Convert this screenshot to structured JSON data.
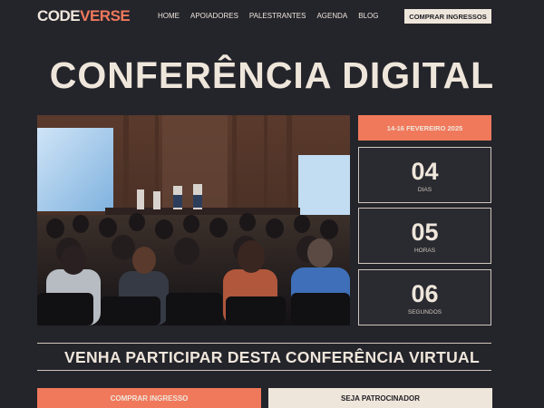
{
  "brand": {
    "part1": "CODE",
    "part2": "VERSE"
  },
  "nav": {
    "items": [
      "HOME",
      "APOIADORES",
      "PALESTRANTES",
      "AGENDA",
      "BLOG"
    ],
    "cta_label": "COMPRAR INGRESSOS"
  },
  "hero": {
    "title": "CONFERÊNCIA DIGITAL",
    "date": "14-16 FEVEREIRO 2025"
  },
  "countdown": [
    {
      "value": "04",
      "label": "DIAS"
    },
    {
      "value": "05",
      "label": "HORAS"
    },
    {
      "value": "06",
      "label": "SEGUNDOS"
    }
  ],
  "tagline": "VENHA PARTICIPAR DESTA CONFERÊNCIA VIRTUAL",
  "actions": {
    "primary": "COMPRAR INGRESSO",
    "secondary": "SEJA PATROCINADOR"
  },
  "colors": {
    "background": "#24242b",
    "accent": "#f0795c",
    "cream": "#efe6db"
  }
}
